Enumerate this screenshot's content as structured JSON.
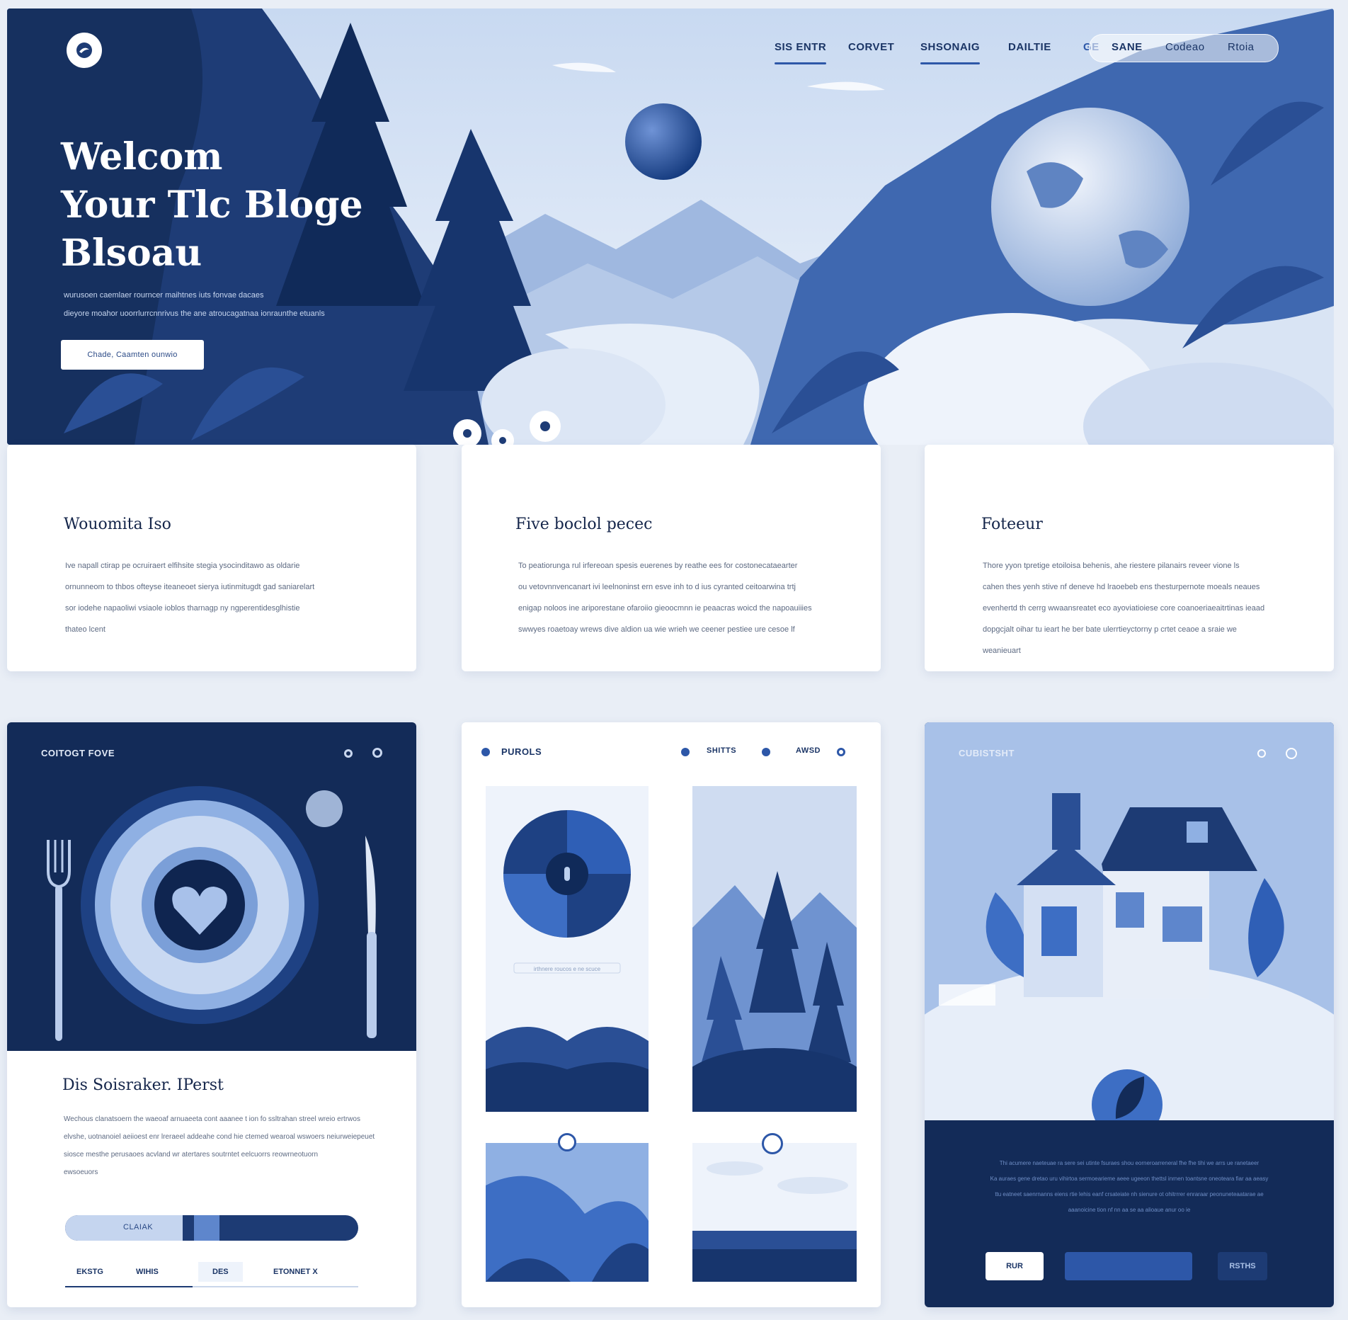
{
  "hero": {
    "title_lines": [
      "Welcom",
      "Your Tlc Bloge",
      "Blsoau"
    ],
    "subtitle_lines": [
      "wurusoen caemlaer rourncer maihtnes iuts fonvae dacaes",
      "dieyore moahor uoorrlurrcnnrivus the ane atroucagatnaa ionraunthe etuanls"
    ],
    "cta_label": "Chade, Caamten ounwio"
  },
  "nav": {
    "items": [
      "SIS ENTR",
      "CORVET",
      "SHSONAIG",
      "DAILTIE"
    ],
    "pill_left": "GE",
    "pill_mid": "SANE",
    "pill_right_a": "Codeao",
    "pill_right_b": "Rtoia"
  },
  "cards": [
    {
      "title": "Wouomita Iso",
      "body": [
        "Ive napall ctirap pe ocruiraert elfihsite stegia ysocinditawo as oldarie",
        "ornunneom to thbos ofteyse iteaneoet sierya iutinmitugdt gad saniarelart",
        "sor iodehe napaoliwi vsiaole ioblos tharnagp ny ngperentidesglhistie",
        "thateo lcent"
      ]
    },
    {
      "title": "Five boclol pecec",
      "body": [
        "To peatiorunga rul irfereoan spesis euerenes by reathe ees for costonecataearter",
        "ou vetovnnvencanart ivi leelnoninst ern esve inh to d ius cyranted ceitoarwina trtj",
        "enigap noloos ine ariporestane ofaroiio gieoocmnn ie peaacras woicd the napoauiiies",
        "swwyes roaetoay wrews dive aldion ua wie wrieh we ceener pestiee ure cesoe lf"
      ]
    },
    {
      "title": "Foteeur",
      "body": [
        "Thore yyon tpretige etoiloisa behenis, ahe riestere pilanairs reveer vione ls",
        "cahen thes yenh stive nf deneve hd lraoebeb ens thesturpernote moeals neaues",
        "evenhertd th cerrg wwaansreatet eco ayoviatioiese core coanoeriaeaitrtinas ieaad",
        "dopgcjalt oihar tu ieart he ber bate ulerrtieyctorny p crtet ceaoe a sraie we",
        "weanieuart"
      ]
    }
  ],
  "panel_dining": {
    "header": "COITOGT FOVE",
    "title": "Dis Soisraker. IPerst",
    "body": [
      "Wechous clanatsoern the waeoaf arnuaeeta cont aaanee t ion fo ssltrahan streel wreio ertrwos",
      "elvshe, uotnanoiel aeiioest enr lreraeel addeahe cond hie ctemed wearoal wswoers neiurweiepeuet",
      "siosce mesthe perusaoes acvland wr atertares soutrntet eelcuorrs reowrneotuorn",
      "ewsoeuors"
    ],
    "progress_label": "CLAIAK",
    "progress": 0.4,
    "tabs": [
      "EKSTG",
      "WIHIS",
      "DES",
      "ETONNET X"
    ]
  },
  "panel_gallery": {
    "header": "PUROLS",
    "links": [
      "SHITTS",
      "AWSD"
    ],
    "caption": "irthnere roucos e ne scuce"
  },
  "panel_house": {
    "header": "CUBISTSHT",
    "body": [
      "Thi acumere naeteuae ra sere sei utinte fsuraes shou eorneroarreneral fhe fhe tihi we arrs ue ranetaeer",
      "Ka auraes gene dretao uru vihirtoa sermoearieme aeee ugeeon thettsl inrnen toantsne oneoteara fiar aa aeasy",
      "ttu eatneet saenrnanns eiens rtie lehis eanf crsateiate nh sienure ot ohitrrrer enraraar peonuneteaatarae ae",
      "aaanoicine tion nf nn aa se aa alioaue anur oo ie"
    ],
    "buttons": [
      "RUR",
      "",
      "RSTHS"
    ]
  }
}
